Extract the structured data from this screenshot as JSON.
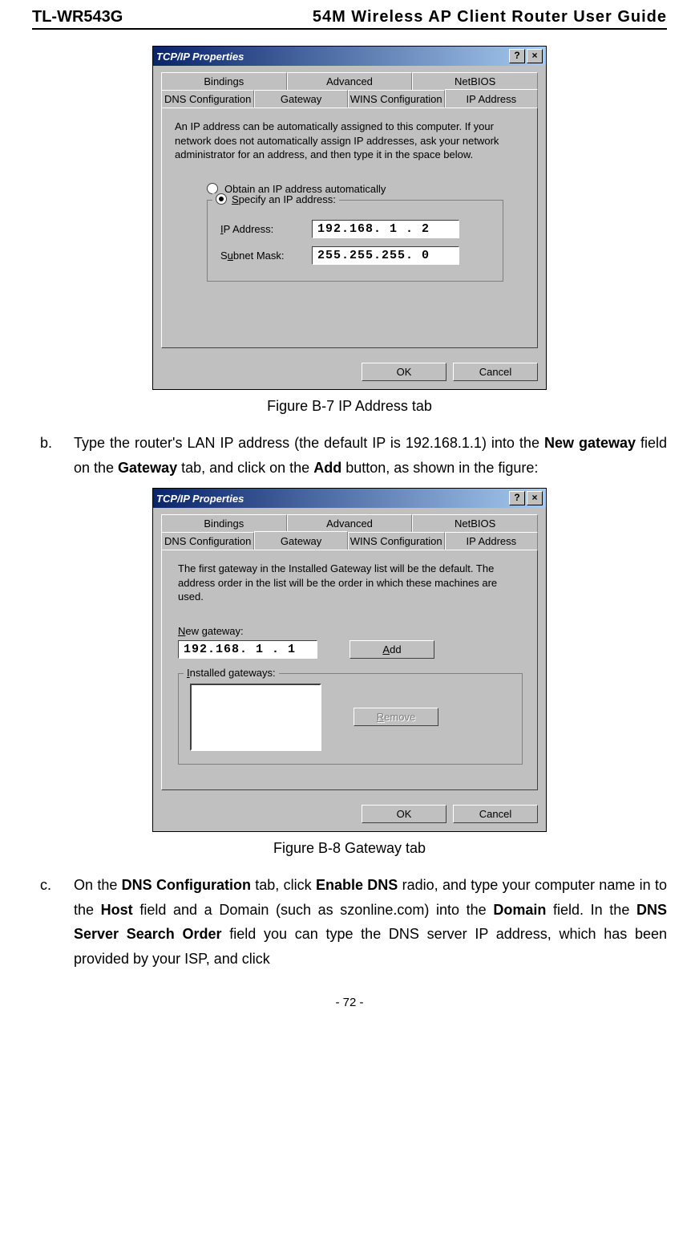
{
  "header": {
    "model": "TL-WR543G",
    "guide": "54M Wireless AP Client Router User Guide"
  },
  "dialog1": {
    "title": "TCP/IP Properties",
    "help_btn": "?",
    "close_btn": "×",
    "tabs_back": [
      "Bindings",
      "Advanced",
      "NetBIOS"
    ],
    "tabs_front": [
      "DNS Configuration",
      "Gateway",
      "WINS Configuration",
      "IP Address"
    ],
    "desc": "An IP address can be automatically assigned to this computer. If your network does not automatically assign IP addresses, ask your network administrator for an address, and then type it in the space below.",
    "radio_obtain_pre": "O",
    "radio_obtain_rest": "btain an IP address automatically",
    "radio_specify_pre": "S",
    "radio_specify_rest": "pecify an IP address:",
    "ip_label_pre": "I",
    "ip_label_rest": "P Address:",
    "ip_value": "192.168. 1 . 2",
    "subnet_label_pre": "S",
    "subnet_label_mid": "u",
    "subnet_label_rest": "bnet Mask:",
    "subnet_value": "255.255.255. 0",
    "ok": "OK",
    "cancel": "Cancel"
  },
  "caption1": "Figure B-7    IP Address tab",
  "step_b": {
    "marker": "b.",
    "t1": "Type the router's LAN IP address (the default IP is 192.168.1.1) into the ",
    "bold1": "New gateway",
    "t2": " field on the ",
    "bold2": "Gateway",
    "t3": " tab, and click on the ",
    "bold3": "Add",
    "t4": " button, as shown in the figure:"
  },
  "dialog2": {
    "title": "TCP/IP Properties",
    "help_btn": "?",
    "close_btn": "×",
    "tabs_back": [
      "Bindings",
      "Advanced",
      "NetBIOS"
    ],
    "tabs_front": [
      "DNS Configuration",
      "Gateway",
      "WINS Configuration",
      "IP Address"
    ],
    "desc": "The first gateway in the Installed Gateway list will be the default. The address order in the list will be the order in which these machines are used.",
    "new_gw_pre": "N",
    "new_gw_rest": "ew gateway:",
    "new_gw_value": "192.168. 1 . 1",
    "add_pre": "A",
    "add_rest": "dd",
    "installed_pre": "I",
    "installed_rest": "nstalled gateways:",
    "remove_pre": "R",
    "remove_rest": "emove",
    "ok": "OK",
    "cancel": "Cancel"
  },
  "caption2": "Figure B-8    Gateway tab",
  "step_c": {
    "marker": "c.",
    "t1": "On the ",
    "bold1": "DNS Configuration",
    "t2": " tab, click ",
    "bold2": "Enable DNS",
    "t3": " radio, and type your computer name in to the ",
    "bold3": "Host",
    "t4": " field and a Domain (such as szonline.com) into the ",
    "bold4": "Domain",
    "t5": " field. In the ",
    "bold5": "DNS Server Search Order",
    "t6": " field you can type the DNS server IP address, which has been provided by your ISP, and click"
  },
  "pagenum": "- 72 -"
}
